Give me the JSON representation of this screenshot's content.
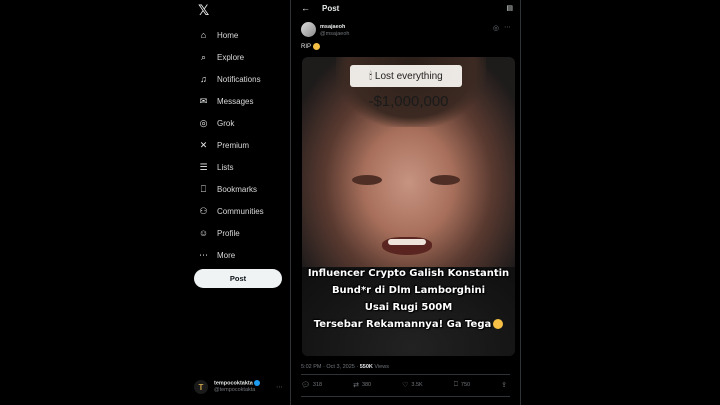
{
  "sidebar": {
    "logo": "𝕏",
    "items": [
      {
        "label": "Home",
        "icon": "home-icon",
        "glyph": "⌂"
      },
      {
        "label": "Explore",
        "icon": "search-icon",
        "glyph": "⌕"
      },
      {
        "label": "Notifications",
        "icon": "bell-icon",
        "glyph": "♫"
      },
      {
        "label": "Messages",
        "icon": "mail-icon",
        "glyph": "✉"
      },
      {
        "label": "Grok",
        "icon": "grok-icon",
        "glyph": "◎"
      },
      {
        "label": "Premium",
        "icon": "x-premium-icon",
        "glyph": "✕"
      },
      {
        "label": "Lists",
        "icon": "list-icon",
        "glyph": "☰"
      },
      {
        "label": "Bookmarks",
        "icon": "bookmark-icon",
        "glyph": "⎕"
      },
      {
        "label": "Communities",
        "icon": "people-icon",
        "glyph": "⚇"
      },
      {
        "label": "Profile",
        "icon": "person-icon",
        "glyph": "☺"
      },
      {
        "label": "More",
        "icon": "more-circle-icon",
        "glyph": "⋯"
      }
    ],
    "post_button": "Post",
    "account": {
      "name": "tempocoktakta",
      "handle": "@tempocoktakta",
      "avatar_letter": "T"
    }
  },
  "header": {
    "back_glyph": "←",
    "title": "Post",
    "reader_glyph": "▤"
  },
  "post": {
    "author_name": "msajaeoh",
    "author_handle": "@msajaeoh",
    "text": "RIP",
    "media": {
      "badge": "🕯 Lost everything",
      "loss": "-$1,000,000",
      "caption_lines": [
        "Influencer Crypto Galish Konstantin",
        "Bund*r di Dlm Lamborghini",
        "Usai Rugi 500M",
        "Tersebar Rekamannya! Ga Tega"
      ]
    },
    "time": "5:02 PM",
    "date": "Oct 3, 2025",
    "views_count": "550K",
    "views_label": "Views",
    "actions": {
      "replies": "318",
      "reposts": "380",
      "likes": "3.5K",
      "bookmarks": "750"
    }
  },
  "colors": {
    "background": "#000000",
    "text": "#e7e9ea",
    "muted": "#71767b",
    "border": "#2f3336",
    "accent": "#1d9bf0"
  }
}
